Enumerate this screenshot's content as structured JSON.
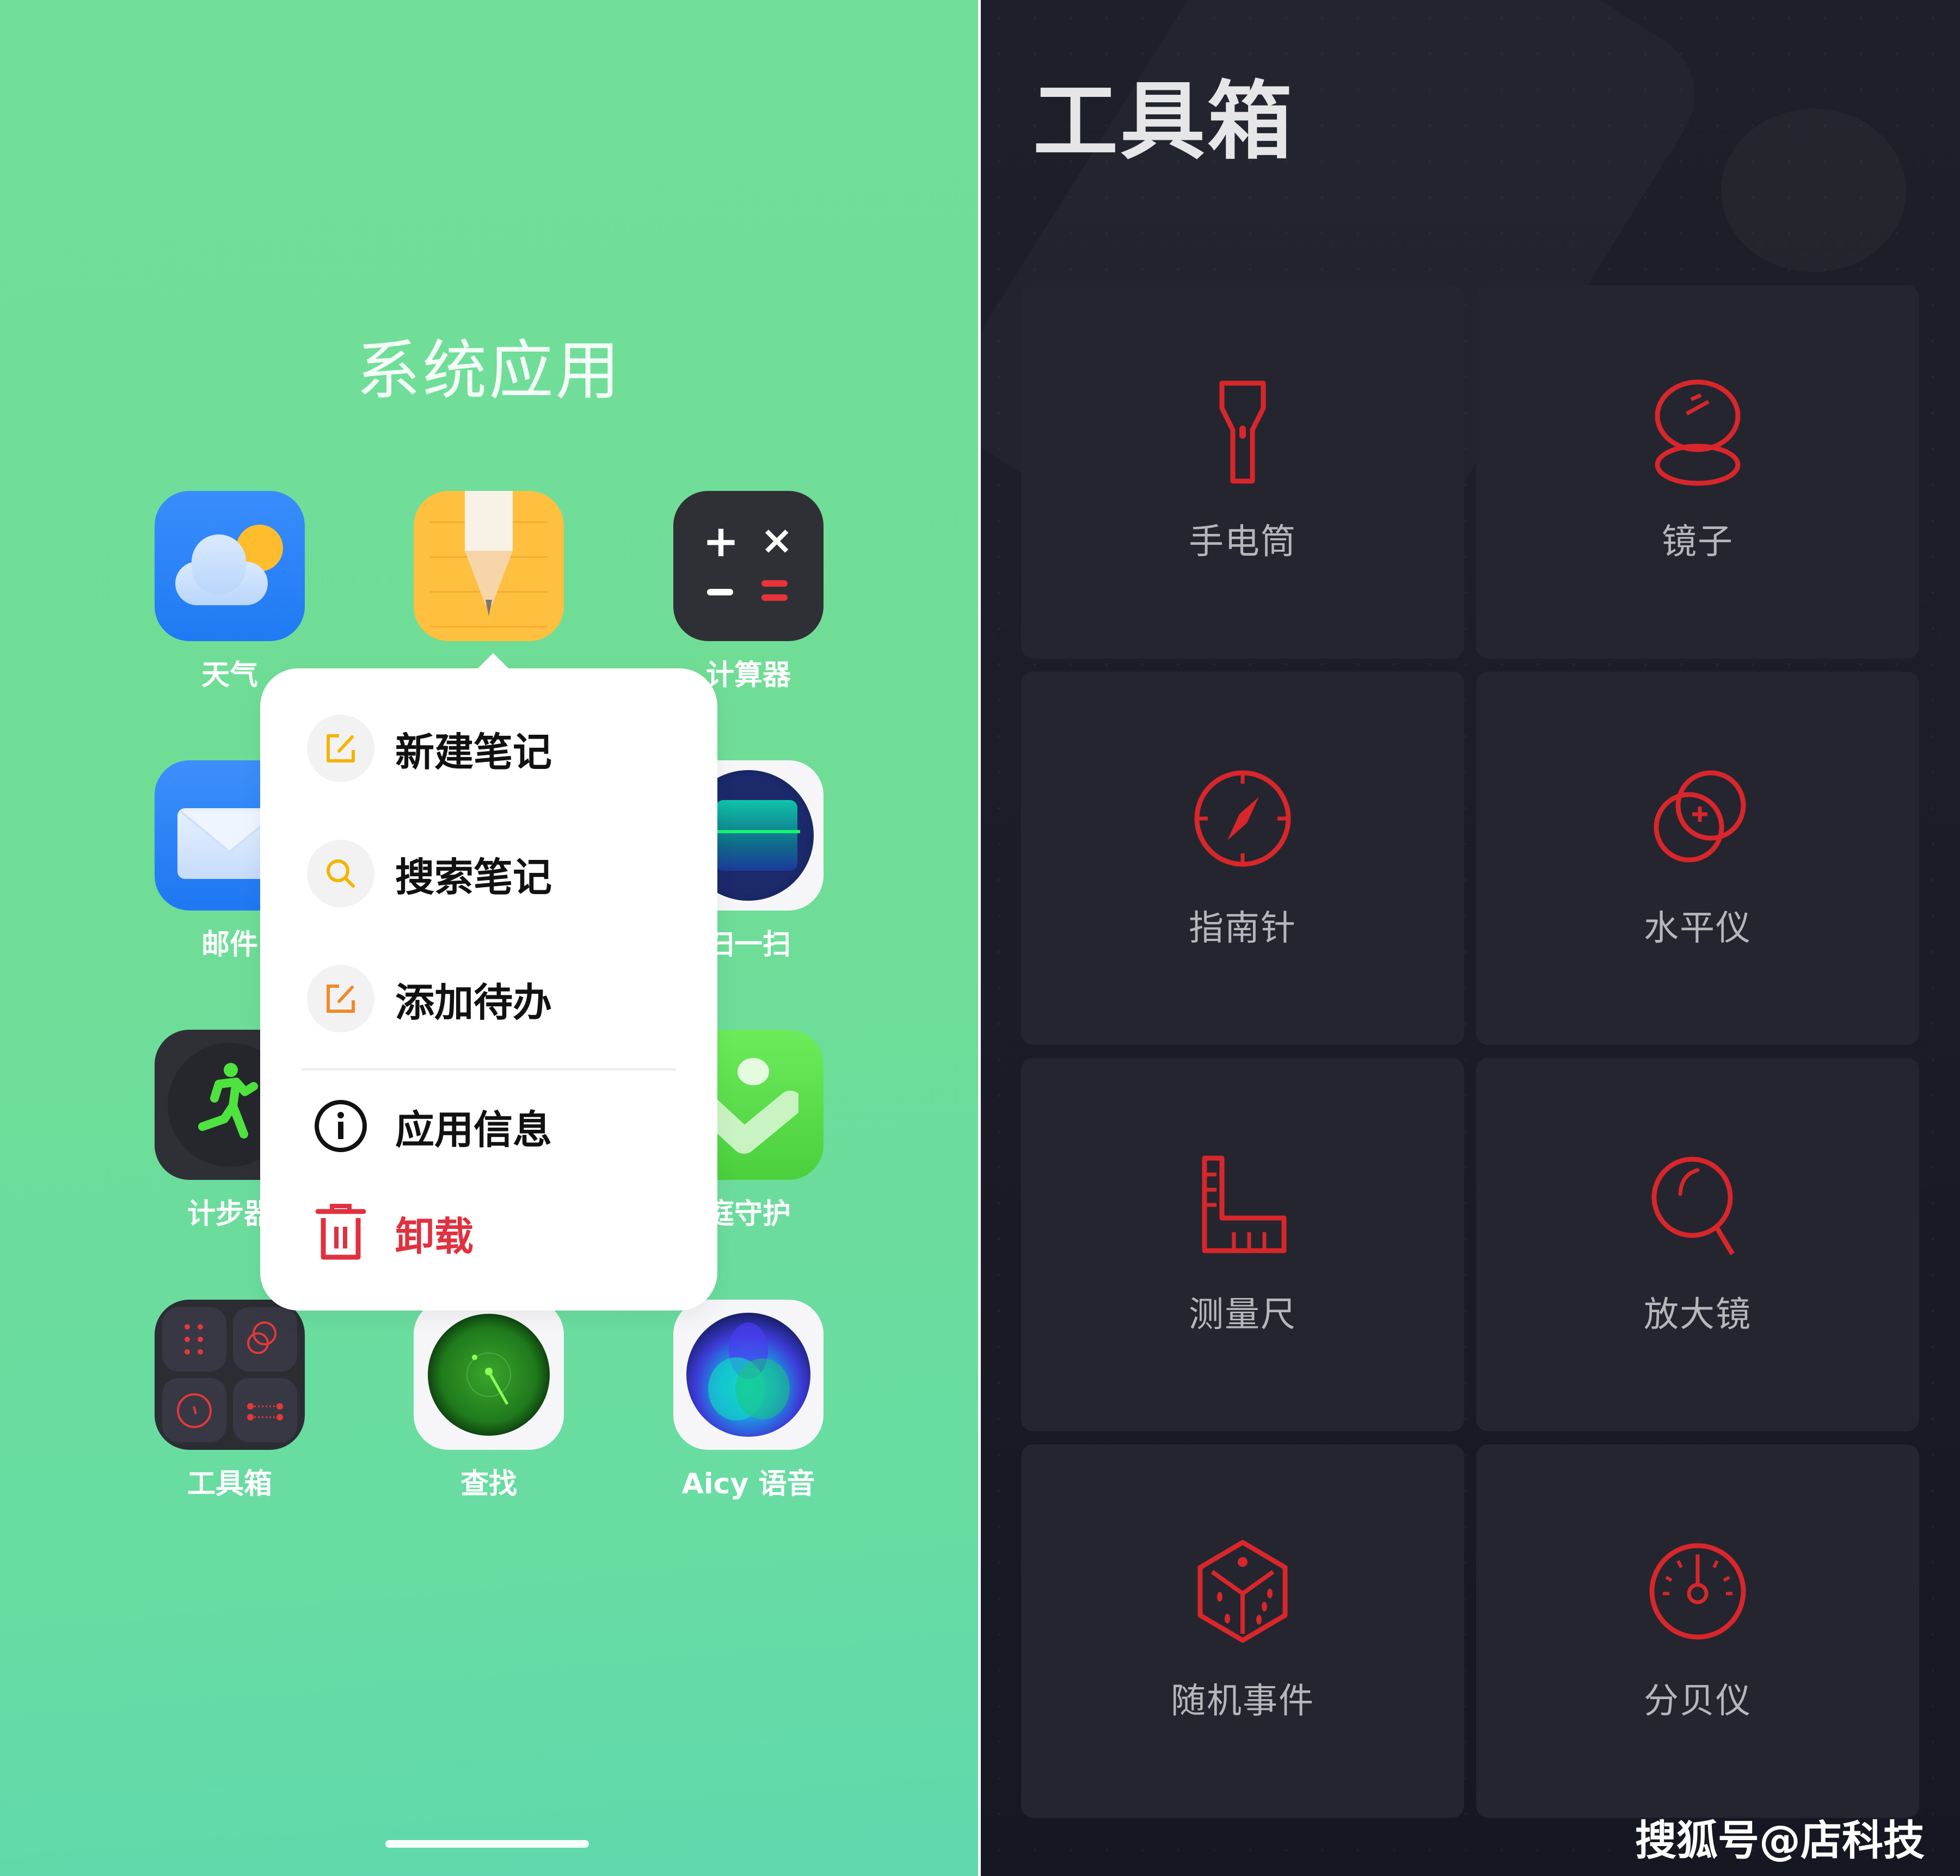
{
  "left_panel": {
    "folder_title": "系统应用",
    "apps": [
      {
        "name": "weather",
        "label": "天气"
      },
      {
        "name": "notes",
        "label": ""
      },
      {
        "name": "calculator",
        "label": "计算器"
      },
      {
        "name": "mail",
        "label": "邮件"
      },
      {
        "name": "scanner",
        "label": "扫一扫"
      },
      {
        "name": "pedometer",
        "label": "计步器"
      },
      {
        "name": "family-guard",
        "label": "家庭守护"
      },
      {
        "name": "toolbox",
        "label": "工具箱"
      },
      {
        "name": "find",
        "label": "查找"
      },
      {
        "name": "aicy-voice",
        "label": "Aicy 语音"
      }
    ],
    "visible_labels": {
      "mail": "邮件",
      "scanner": "扫一扫",
      "pedometer": "计步器",
      "family_guard": "庭守护"
    },
    "context_menu": {
      "items": [
        {
          "label": "新建笔记",
          "icon": "new-note-icon",
          "color": "#f5b400"
        },
        {
          "label": "搜索笔记",
          "icon": "search-icon",
          "color": "#f5b400"
        },
        {
          "label": "添加待办",
          "icon": "add-todo-icon",
          "color": "#f08a2c"
        },
        {
          "label": "应用信息",
          "icon": "info-icon",
          "color": "#111111"
        },
        {
          "label": "卸载",
          "icon": "trash-icon",
          "color": "#e0313f"
        }
      ]
    }
  },
  "right_panel": {
    "title": "工具箱",
    "accent_color": "#d8262b",
    "tools": [
      {
        "label": "手电筒",
        "icon": "flashlight-icon"
      },
      {
        "label": "镜子",
        "icon": "mirror-icon"
      },
      {
        "label": "指南针",
        "icon": "compass-icon"
      },
      {
        "label": "水平仪",
        "icon": "level-icon"
      },
      {
        "label": "测量尺",
        "icon": "ruler-icon"
      },
      {
        "label": "放大镜",
        "icon": "magnifier-icon"
      },
      {
        "label": "随机事件",
        "icon": "dice-icon"
      },
      {
        "label": "分贝仪",
        "icon": "decibel-meter-icon"
      }
    ]
  },
  "watermark": "搜狐号@店科技"
}
